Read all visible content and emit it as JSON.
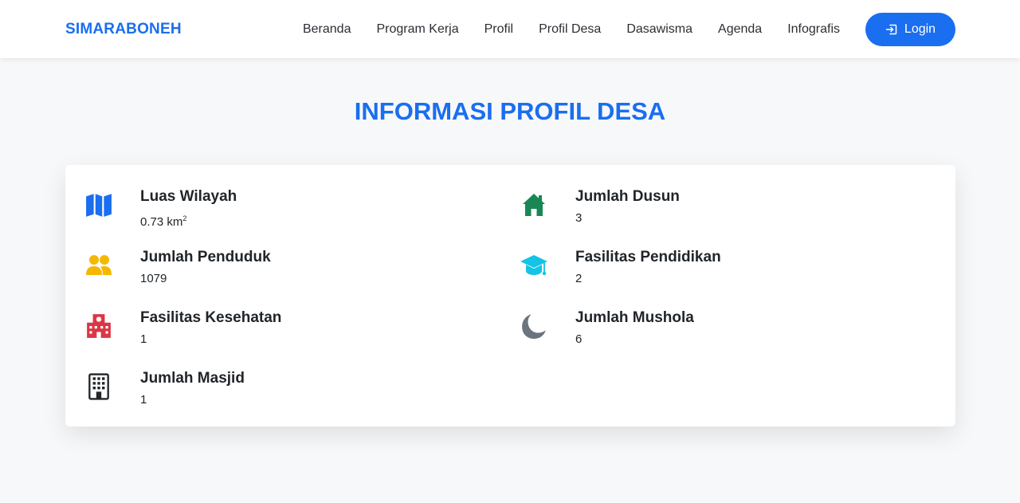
{
  "brand": "SIMARABONEH",
  "nav": [
    "Beranda",
    "Program Kerja",
    "Profil",
    "Profil Desa",
    "Dasawisma",
    "Agenda",
    "Infografis"
  ],
  "login_label": "Login",
  "page_title": "INFORMASI PROFIL DESA",
  "stats": {
    "luas": {
      "label": "Luas Wilayah",
      "value": "0.73 km",
      "unit_sup": "2",
      "icon": "map-icon",
      "color": "#1a6ef0"
    },
    "penduduk": {
      "label": "Jumlah Penduduk",
      "value": "1079",
      "icon": "people-icon",
      "color": "#f5b800"
    },
    "kesehatan": {
      "label": "Fasilitas Kesehatan",
      "value": "1",
      "icon": "hospital-icon",
      "color": "#dc3545"
    },
    "masjid": {
      "label": "Jumlah Masjid",
      "value": "1",
      "icon": "building-icon",
      "color": "#212529"
    },
    "dusun": {
      "label": "Jumlah Dusun",
      "value": "3",
      "icon": "house-icon",
      "color": "#198754"
    },
    "pendidikan": {
      "label": "Fasilitas Pendidikan",
      "value": "2",
      "icon": "mortarboard-icon",
      "color": "#14c3e6"
    },
    "mushola": {
      "label": "Jumlah Mushola",
      "value": "6",
      "icon": "moon-icon",
      "color": "#6c757d"
    }
  }
}
